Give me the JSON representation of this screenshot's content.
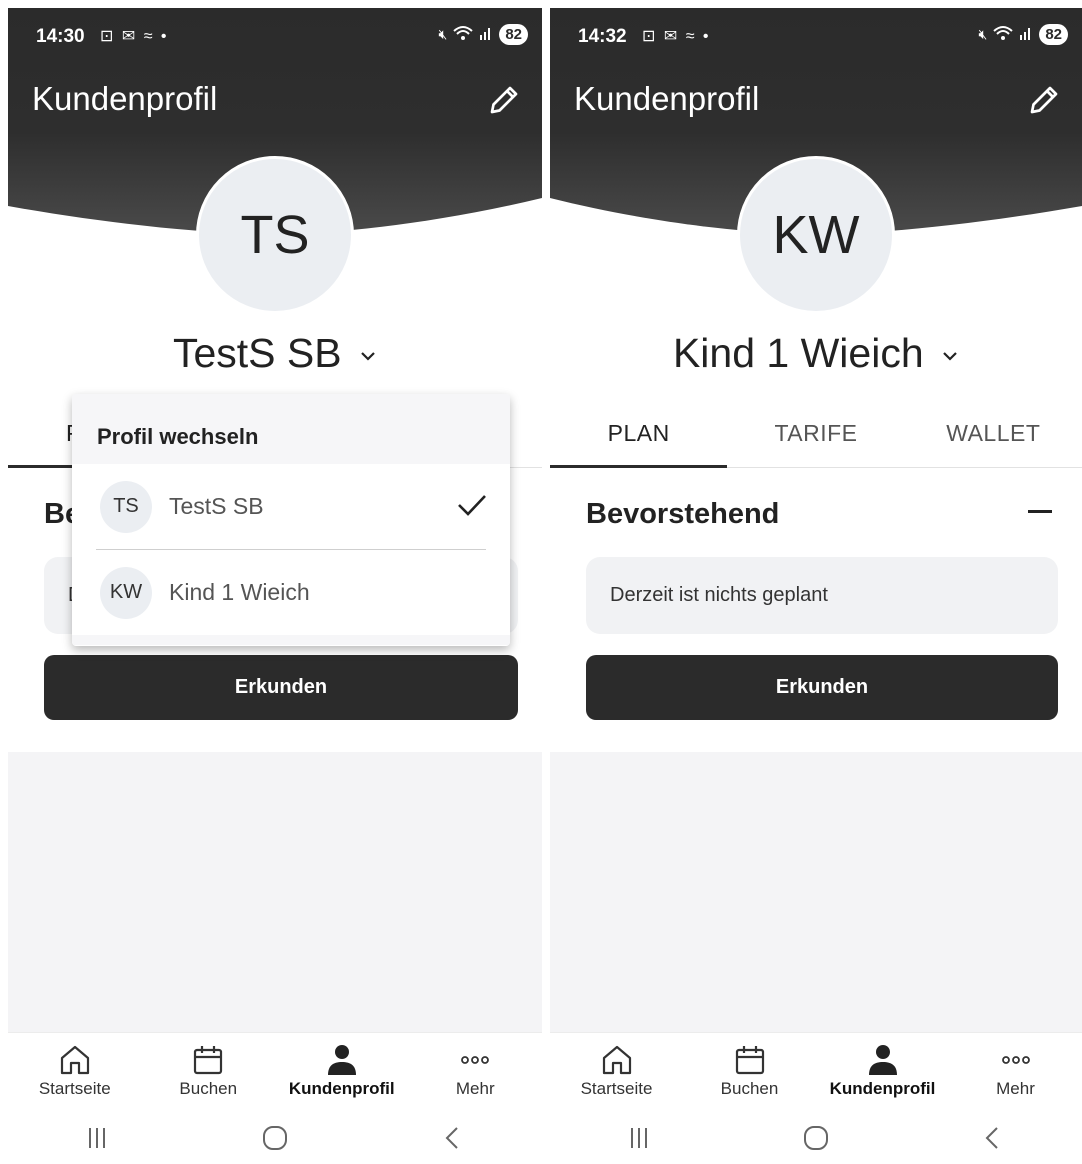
{
  "left": {
    "status": {
      "time": "14:30",
      "icons_left": "⊡ ✉ ≈ •",
      "battery": "82"
    },
    "app_title": "Kundenprofil",
    "avatar_initials": "TS",
    "profile_name": "TestS SB",
    "tab_peek": "P",
    "section_peek": "Be",
    "card_peek": "D",
    "cta_label": "Erkunden",
    "dropdown": {
      "title": "Profil wechseln",
      "items": [
        {
          "initials": "TS",
          "label": "TestS SB",
          "selected": true
        },
        {
          "initials": "KW",
          "label": "Kind 1 Wieich",
          "selected": false
        }
      ]
    },
    "nav": [
      {
        "label": "Startseite",
        "icon": "home-icon"
      },
      {
        "label": "Buchen",
        "icon": "calendar-icon"
      },
      {
        "label": "Kundenprofil",
        "icon": "person-icon"
      },
      {
        "label": "Mehr",
        "icon": "more-icon"
      }
    ]
  },
  "right": {
    "status": {
      "time": "14:32",
      "icons_left": "⊡ ✉ ≈ •",
      "battery": "82"
    },
    "app_title": "Kundenprofil",
    "avatar_initials": "KW",
    "profile_name": "Kind 1 Wieich",
    "tabs": [
      "PLAN",
      "TARIFE",
      "WALLET"
    ],
    "section_title": "Bevorstehend",
    "empty_text": "Derzeit ist nichts geplant",
    "cta_label": "Erkunden",
    "nav": [
      {
        "label": "Startseite",
        "icon": "home-icon"
      },
      {
        "label": "Buchen",
        "icon": "calendar-icon"
      },
      {
        "label": "Kundenprofil",
        "icon": "person-icon"
      },
      {
        "label": "Mehr",
        "icon": "more-icon"
      }
    ]
  },
  "colors": {
    "header": "#2b2b2b",
    "accent": "#2b2b2b",
    "card": "#f1f2f4",
    "avatar": "#ebeef2"
  }
}
